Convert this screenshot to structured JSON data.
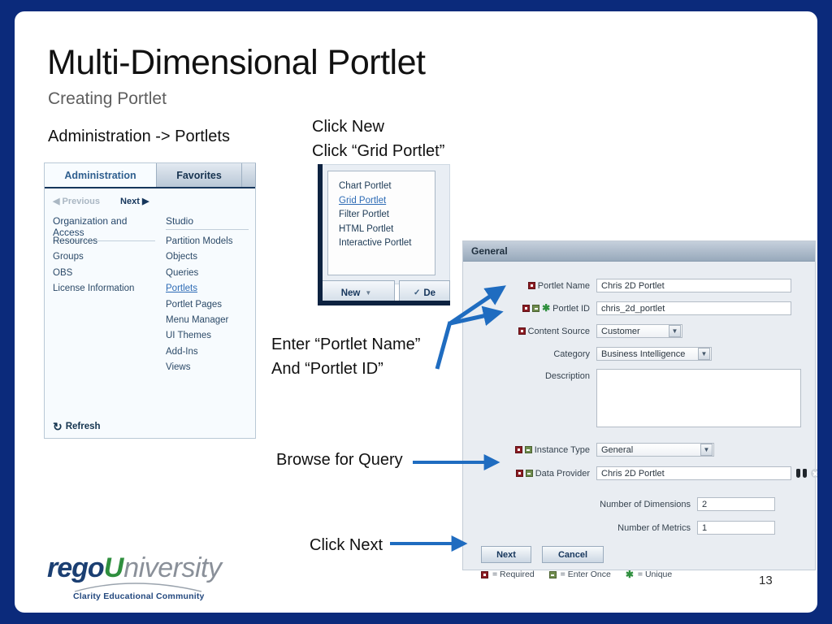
{
  "slide": {
    "title": "Multi-Dimensional Portlet",
    "subtitle": "Creating Portlet",
    "page_number": "13",
    "border_color": "#0b2a7b"
  },
  "annotations": {
    "admin_path": "Administration -> Portlets",
    "click_new_line1": "Click New",
    "click_new_line2": "Click “Grid Portlet”",
    "enter_line1": "Enter “Portlet Name”",
    "enter_line2": "And “Portlet ID”",
    "browse_for_query": "Browse for Query",
    "click_next": "Click Next",
    "arrow_color": "#1f6cc0"
  },
  "admin_panel": {
    "tabs": [
      {
        "label": "Administration",
        "active": true
      },
      {
        "label": "Favorites",
        "active": false
      }
    ],
    "nav": {
      "previous": "◀ Previous",
      "next": "Next ▶"
    },
    "columns": [
      {
        "header": "Organization and Access",
        "items": [
          {
            "label": "Resources",
            "link": false
          },
          {
            "label": "Groups",
            "link": false
          },
          {
            "label": "OBS",
            "link": false
          },
          {
            "label": "License Information",
            "link": false
          }
        ]
      },
      {
        "header": "Studio",
        "items": [
          {
            "label": "Partition Models",
            "link": false
          },
          {
            "label": "Objects",
            "link": false
          },
          {
            "label": "Queries",
            "link": false
          },
          {
            "label": "Portlets",
            "link": true
          },
          {
            "label": "Portlet Pages",
            "link": false
          },
          {
            "label": "Menu Manager",
            "link": false
          },
          {
            "label": "UI Themes",
            "link": false
          },
          {
            "label": "Add-Ins",
            "link": false
          },
          {
            "label": "Views",
            "link": false
          }
        ]
      }
    ],
    "refresh_label": "Refresh"
  },
  "new_menu": {
    "items": [
      {
        "label": "Chart Portlet",
        "selected": false
      },
      {
        "label": "Grid Portlet",
        "selected": true
      },
      {
        "label": "Filter Portlet",
        "selected": false
      },
      {
        "label": "HTML Portlet",
        "selected": false
      },
      {
        "label": "Interactive Portlet",
        "selected": false
      }
    ],
    "new_button": "New",
    "new_button_caret": "▼",
    "delete_button": "De"
  },
  "general_form": {
    "header": "General",
    "fields": {
      "portlet_name": {
        "label": "Portlet Name",
        "value": "Chris 2D Portlet"
      },
      "portlet_id": {
        "label": "Portlet ID",
        "value": "chris_2d_portlet"
      },
      "content_source": {
        "label": "Content Source",
        "value": "Customer"
      },
      "category": {
        "label": "Category",
        "value": "Business Intelligence"
      },
      "description": {
        "label": "Description",
        "value": ""
      },
      "instance_type": {
        "label": "Instance Type",
        "value": "General"
      },
      "data_provider": {
        "label": "Data Provider",
        "value": "Chris 2D Portlet"
      },
      "number_of_dimensions": {
        "label": "Number of Dimensions",
        "value": "2"
      },
      "number_of_metrics": {
        "label": "Number of Metrics",
        "value": "1"
      }
    },
    "buttons": {
      "next": "Next",
      "cancel": "Cancel"
    },
    "legend": {
      "required": "= Required",
      "enter_once": "= Enter Once",
      "unique": "= Unique"
    },
    "select_caret": "▼"
  },
  "logo": {
    "rego": "rego",
    "u": "U",
    "niversity": "niversity",
    "tagline": "Clarity Educational Community"
  }
}
